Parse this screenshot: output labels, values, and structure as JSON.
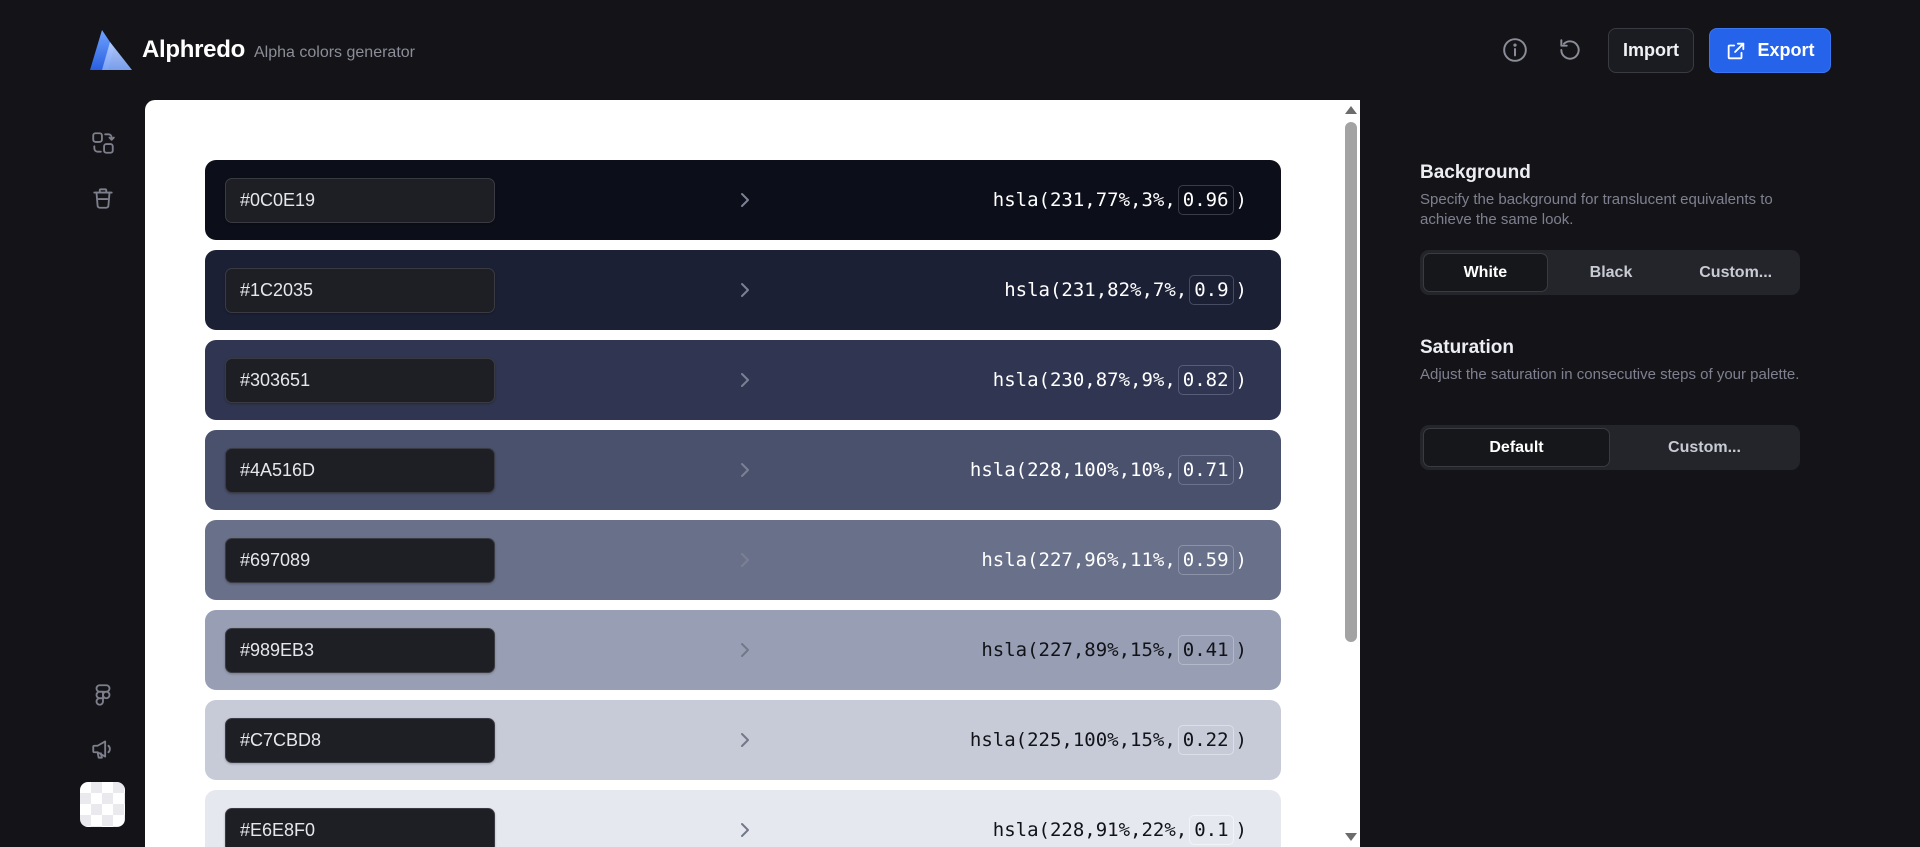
{
  "app": {
    "name": "Alphredo",
    "tagline": "Alpha colors generator"
  },
  "header": {
    "info_icon": "info-icon",
    "reset_icon": "reset-icon",
    "import_label": "Import",
    "export_label": "Export",
    "export_icon": "share-icon"
  },
  "sidebar": {
    "top_icons": [
      "palette-swap-icon",
      "trash-icon"
    ],
    "bottom_icons": [
      "figma-icon",
      "megaphone-icon"
    ],
    "swatch_label": "background-swatch"
  },
  "palette": [
    {
      "hex": "#0C0E19",
      "bg": "#0C0E19",
      "text": "#ffffff",
      "box": "#3a3c48",
      "hsla_prefix": "hsla(231,77%,3%,",
      "alpha": "0.96",
      "hsla_suffix": ")"
    },
    {
      "hex": "#1C2035",
      "bg": "#1C2035",
      "text": "#ffffff",
      "box": "#474b63",
      "hsla_prefix": "hsla(231,82%,7%,",
      "alpha": "0.9",
      "hsla_suffix": ")"
    },
    {
      "hex": "#303651",
      "bg": "#303651",
      "text": "#ffffff",
      "box": "#575d78",
      "hsla_prefix": "hsla(230,87%,9%,",
      "alpha": "0.82",
      "hsla_suffix": ")"
    },
    {
      "hex": "#4A516D",
      "bg": "#4A516D",
      "text": "#ffffff",
      "box": "#6c7390",
      "hsla_prefix": "hsla(228,100%,10%,",
      "alpha": "0.71",
      "hsla_suffix": ")"
    },
    {
      "hex": "#697089",
      "bg": "#697089",
      "text": "#ffffff",
      "box": "#8c92a8",
      "hsla_prefix": "hsla(227,96%,11%,",
      "alpha": "0.59",
      "hsla_suffix": ")"
    },
    {
      "hex": "#989EB3",
      "bg": "#989EB3",
      "text": "#111318",
      "box": "#b4b9ca",
      "hsla_prefix": "hsla(227,89%,15%,",
      "alpha": "0.41",
      "hsla_suffix": ")"
    },
    {
      "hex": "#C7CBD8",
      "bg": "#C7CBD8",
      "text": "#111318",
      "box": "#dcdfe8",
      "hsla_prefix": "hsla(225,100%,15%,",
      "alpha": "0.22",
      "hsla_suffix": ")"
    },
    {
      "hex": "#E6E8F0",
      "bg": "#E6E8F0",
      "text": "#111318",
      "box": "#f3f4f8",
      "hsla_prefix": "hsla(228,91%,22%,",
      "alpha": "0.1",
      "hsla_suffix": ")"
    }
  ],
  "settings": {
    "background": {
      "title": "Background",
      "description": "Specify the background for translucent equivalents to achieve the same look.",
      "options": [
        "White",
        "Black",
        "Custom..."
      ],
      "selected": "White"
    },
    "saturation": {
      "title": "Saturation",
      "description": "Adjust the saturation in consecutive steps of your palette.",
      "options": [
        "Default",
        "Custom..."
      ],
      "selected": "Default"
    }
  },
  "colors": {
    "accent": "#2563eb",
    "app_bg": "#141418",
    "canvas_bg": "#ffffff"
  }
}
